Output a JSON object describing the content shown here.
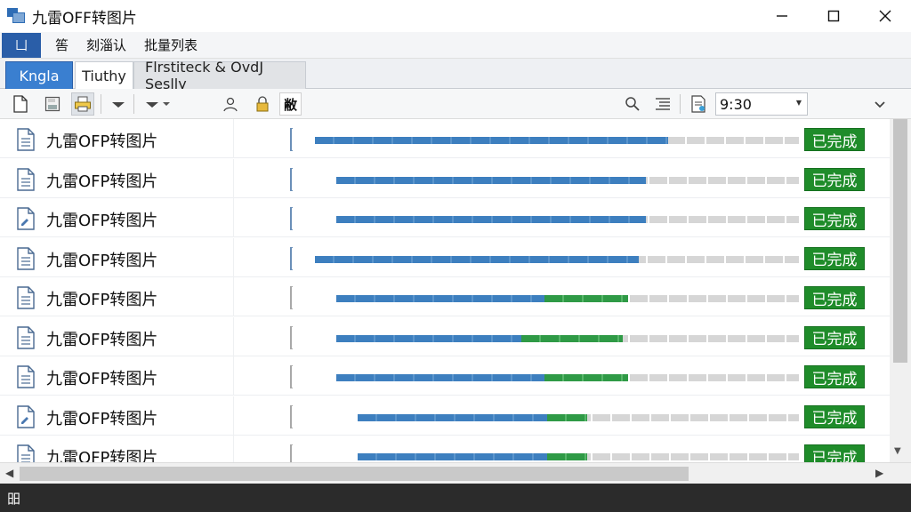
{
  "window": {
    "title": "九雷OFF转图片"
  },
  "menu": {
    "file_glyph": "凵",
    "items": [
      "筶",
      "刻淄认",
      "批量列表"
    ]
  },
  "tabs": [
    {
      "label": "Kngla"
    },
    {
      "label": "Tiuthy"
    },
    {
      "label": "Flrstiteck & OvdJ Seslly"
    }
  ],
  "toolbar": {
    "label": "敝",
    "time_value": "9:30"
  },
  "colors": {
    "accent_blue": "#3a7fd0",
    "progress_blue": "#3d7fbf",
    "progress_green": "#2f9a46",
    "status_green": "#1f8c2a",
    "statusbar_bg": "#2b2b2b"
  },
  "rows": [
    {
      "name": "九雷OFP转图片",
      "status": "已完成",
      "icon": "document-icon",
      "blue": 0.73,
      "green": 0.0
    },
    {
      "name": "九雷OFP转图片",
      "status": "已完成",
      "icon": "document-icon",
      "blue": 0.67,
      "green": 0.0
    },
    {
      "name": "九雷OFP转图片",
      "status": "已完成",
      "icon": "document-edit-icon",
      "blue": 0.67,
      "green": 0.0
    },
    {
      "name": "九雷OFP转图片",
      "status": "已完成",
      "icon": "document-icon",
      "blue": 0.67,
      "green": 0.0
    },
    {
      "name": "九雷OFP转图片",
      "status": "已完成",
      "icon": "document-icon",
      "blue": 0.45,
      "green": 0.18
    },
    {
      "name": "九雷OFP转图片",
      "status": "已完成",
      "icon": "document-icon",
      "blue": 0.4,
      "green": 0.22
    },
    {
      "name": "九雷OFP转图片",
      "status": "已完成",
      "icon": "document-icon",
      "blue": 0.45,
      "green": 0.18
    },
    {
      "name": "九雷OFP转图片",
      "status": "已完成",
      "icon": "document-edit-icon",
      "blue": 0.43,
      "green": 0.09
    },
    {
      "name": "九雷OFP转图片",
      "status": "已完成",
      "icon": "document-icon",
      "blue": 0.43,
      "green": 0.09
    }
  ],
  "statusbar": {
    "text": "昍"
  }
}
